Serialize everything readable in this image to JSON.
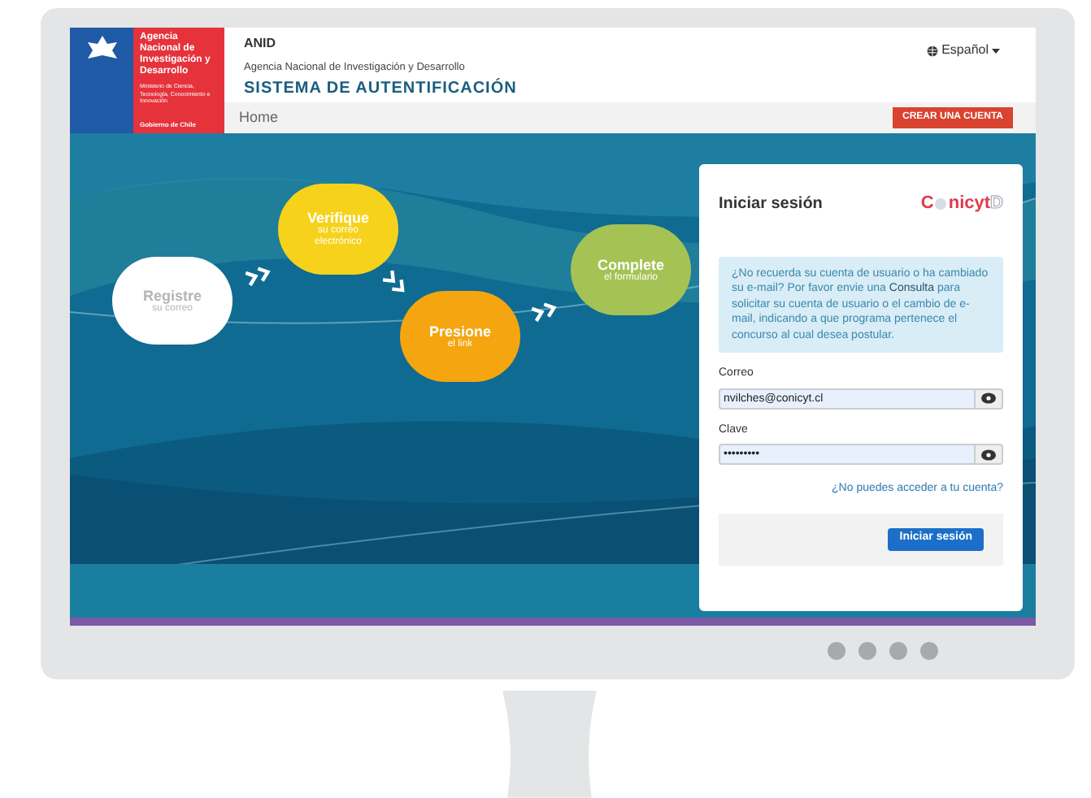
{
  "header": {
    "logo": {
      "agency": "Agencia Nacional de Investigación y Desarrollo",
      "ministry": "Ministerio de Ciencia, Tecnología, Conocimiento e Innovación",
      "government": "Gobierno de Chile"
    },
    "acronym": "ANID",
    "agency_name": "Agencia Nacional de Investigación y Desarrollo",
    "system_title": "SISTEMA DE AUTENTIFICACIÓN",
    "language": "Español"
  },
  "nav": {
    "items": [
      {
        "label": "Home",
        "selected": false
      }
    ],
    "button": "CREAR UNA CUENTA"
  },
  "steps": [
    {
      "title": "Registre",
      "subtitle": "su correo",
      "color": "#ffffff"
    },
    {
      "title": "Verifique",
      "subtitle": "su correo electrónico",
      "color": "#f7d21b"
    },
    {
      "title": "Presione",
      "subtitle": "el link",
      "color": "#f5a50f"
    },
    {
      "title": "Complete",
      "subtitle": "el formulario",
      "color": "#a5c254"
    }
  ],
  "login": {
    "title": "Iniciar sesión",
    "logo": [
      "C",
      "nicyt",
      "D"
    ],
    "info": {
      "before": "¿No recuerda su cuenta de usuario o ha cambiado su e-mail? Por favor envie una",
      "link": "Consulta",
      "after": "para solicitar su cuenta de usuario o el cambio de e-mail, indicando a que programa pertenece el concurso al cual desea postular."
    },
    "fields": [
      {
        "label": "Correo",
        "value": "nvilches@conicyt.cl"
      },
      {
        "label": "Clave",
        "value": "•••••••••"
      }
    ],
    "help_link": "¿No puedes acceder a tu cuenta?",
    "submit": "Iniciar sesión"
  }
}
